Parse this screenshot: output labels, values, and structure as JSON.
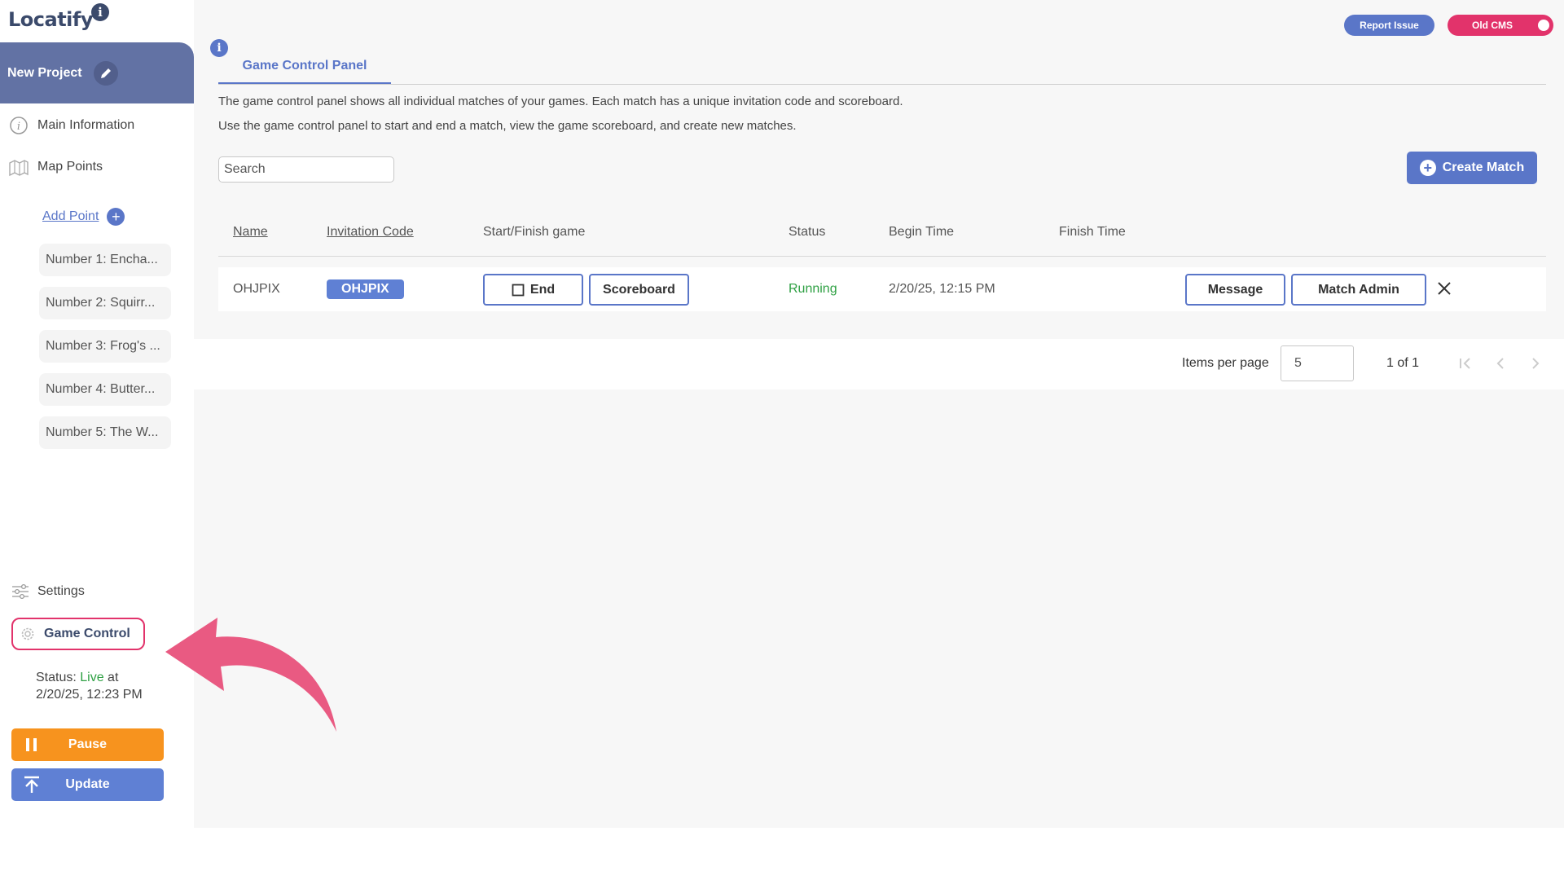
{
  "brand": {
    "name": "Locatify",
    "badge": "i"
  },
  "project": {
    "title": "New Project"
  },
  "sidebar": {
    "nav": [
      {
        "label": "Main Information",
        "icon": "info-circle-icon"
      },
      {
        "label": "Map Points",
        "icon": "map-icon"
      }
    ],
    "add_point_label": "Add Point",
    "points": [
      "Number 1: Encha...",
      "Number 2: Squirr...",
      "Number 3: Frog's ...",
      "Number 4: Butter...",
      "Number 5: The W..."
    ],
    "settings_label": "Settings",
    "game_control_label": "Game Control",
    "status": {
      "prefix": "Status: ",
      "state": "Live",
      "suffix": " at 2/20/25, 12:23 PM"
    },
    "pause_label": "Pause",
    "update_label": "Update"
  },
  "topbar": {
    "report_label": "Report Issue",
    "old_cms_label": "Old CMS"
  },
  "main": {
    "tab_label": "Game Control Panel",
    "description_1": "The game control panel shows all individual matches of your games. Each match has a unique invitation code and scoreboard.",
    "description_2": "Use the game control panel to start and end a match, view the game scoreboard, and create new matches.",
    "search_placeholder": "Search",
    "create_label": "Create Match"
  },
  "table": {
    "headers": {
      "name": "Name",
      "code": "Invitation Code",
      "startfinish": "Start/Finish game",
      "status": "Status",
      "begin": "Begin Time",
      "finish": "Finish Time"
    },
    "rows": [
      {
        "name": "OHJPIX",
        "code": "OHJPIX",
        "end_label": "End",
        "scoreboard_label": "Scoreboard",
        "status": "Running",
        "begin": "2/20/25, 12:15 PM",
        "finish": "",
        "message_label": "Message",
        "admin_label": "Match Admin"
      }
    ]
  },
  "pagination": {
    "items_label": "Items per page",
    "per_page": "5",
    "range": "1 of 1"
  },
  "colors": {
    "accent": "#5a76c8",
    "highlight": "#e2336b",
    "live": "#2ea043",
    "pause": "#f7931e",
    "header": "#6272a4"
  }
}
